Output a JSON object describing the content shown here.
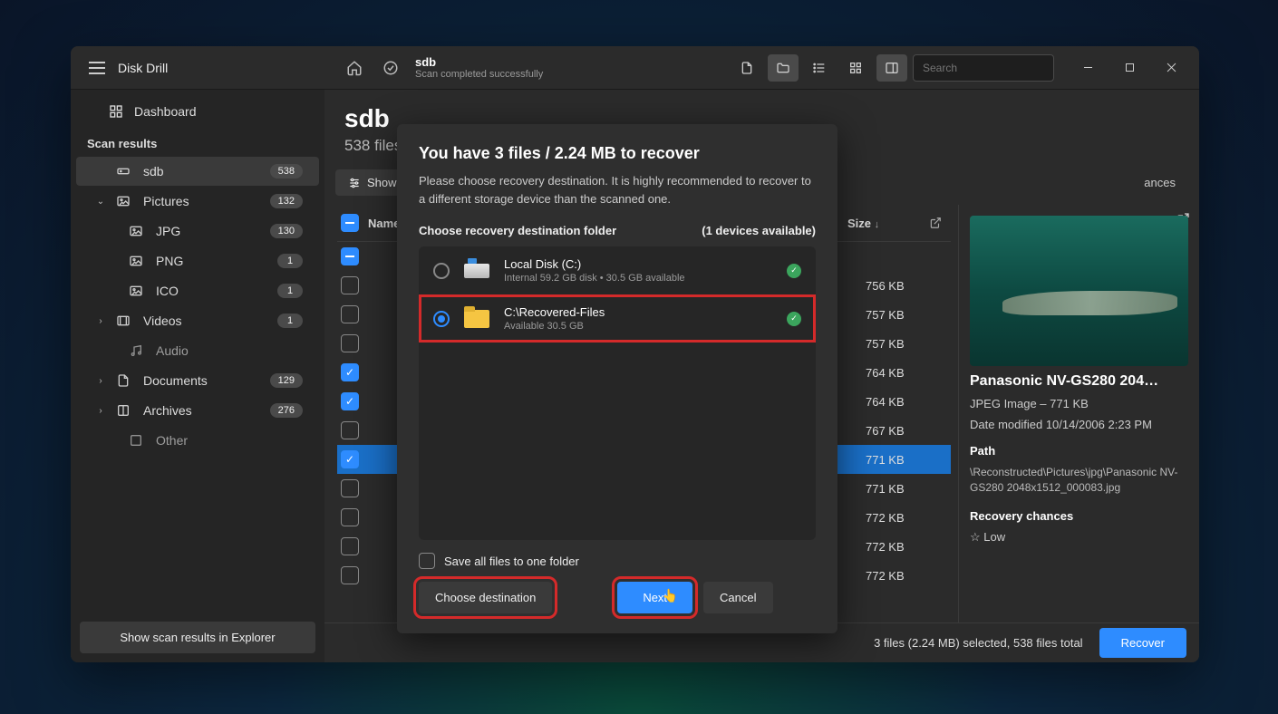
{
  "app": {
    "title": "Disk Drill"
  },
  "titlebar": {
    "crumb_title": "sdb",
    "crumb_sub": "Scan completed successfully",
    "search_placeholder": "Search"
  },
  "sidebar": {
    "dashboard": "Dashboard",
    "section": "Scan results",
    "items": [
      {
        "label": "sdb",
        "badge": "538",
        "icon": "drive",
        "active": true
      },
      {
        "label": "Pictures",
        "badge": "132",
        "icon": "image",
        "expand": "open"
      },
      {
        "label": "JPG",
        "badge": "130",
        "icon": "image",
        "child": true
      },
      {
        "label": "PNG",
        "badge": "1",
        "icon": "image",
        "child": true
      },
      {
        "label": "ICO",
        "badge": "1",
        "icon": "image",
        "child": true
      },
      {
        "label": "Videos",
        "badge": "1",
        "icon": "video",
        "expand": "closed"
      },
      {
        "label": "Audio",
        "badge": "",
        "icon": "audio",
        "child": true,
        "dim": true
      },
      {
        "label": "Documents",
        "badge": "129",
        "icon": "doc",
        "expand": "closed"
      },
      {
        "label": "Archives",
        "badge": "276",
        "icon": "archive",
        "expand": "closed"
      },
      {
        "label": "Other",
        "badge": "",
        "icon": "other",
        "child": true,
        "dim": true
      }
    ],
    "explorer_btn": "Show scan results in Explorer"
  },
  "main": {
    "title": "sdb",
    "sub": "538 files",
    "tabs": {
      "show": "Show",
      "chances": "ances"
    },
    "th": {
      "name": "Name",
      "size": "Size"
    },
    "rows": [
      {
        "chk": "ind",
        "size": ""
      },
      {
        "chk": "",
        "size": "756 KB"
      },
      {
        "chk": "",
        "size": "757 KB"
      },
      {
        "chk": "",
        "size": "757 KB"
      },
      {
        "chk": "on",
        "size": "764 KB"
      },
      {
        "chk": "on",
        "size": "764 KB"
      },
      {
        "chk": "",
        "size": "767 KB"
      },
      {
        "chk": "on",
        "size": "771 KB",
        "sel": true
      },
      {
        "chk": "",
        "size": "771 KB"
      },
      {
        "chk": "",
        "size": "772 KB"
      },
      {
        "chk": "",
        "size": "772 KB"
      },
      {
        "chk": "",
        "size": "772 KB"
      }
    ]
  },
  "preview": {
    "title": "Panasonic NV-GS280 204…",
    "type": "JPEG Image – 771 KB",
    "modified": "Date modified 10/14/2006 2:23 PM",
    "path_label": "Path",
    "path": "\\Reconstructed\\Pictures\\jpg\\Panasonic NV-GS280 2048x1512_000083.jpg",
    "chances_label": "Recovery chances",
    "chances": "Low"
  },
  "status": {
    "text": "3 files (2.24 MB) selected, 538 files total",
    "recover": "Recover"
  },
  "modal": {
    "title": "You have 3 files / 2.24 MB to recover",
    "text": "Please choose recovery destination. It is highly recommended to recover to a different storage device than the scanned one.",
    "choose_label": "Choose recovery destination folder",
    "devices": "(1 devices available)",
    "dests": [
      {
        "name": "Local Disk (C:)",
        "sub": "Internal 59.2 GB disk • 30.5 GB available",
        "sel": false,
        "kind": "drive"
      },
      {
        "name": "C:\\Recovered-Files",
        "sub": "Available 30.5 GB",
        "sel": true,
        "kind": "folder",
        "hl": true
      }
    ],
    "save_all": "Save all files to one folder",
    "choose": "Choose destination",
    "next": "Next",
    "cancel": "Cancel"
  }
}
